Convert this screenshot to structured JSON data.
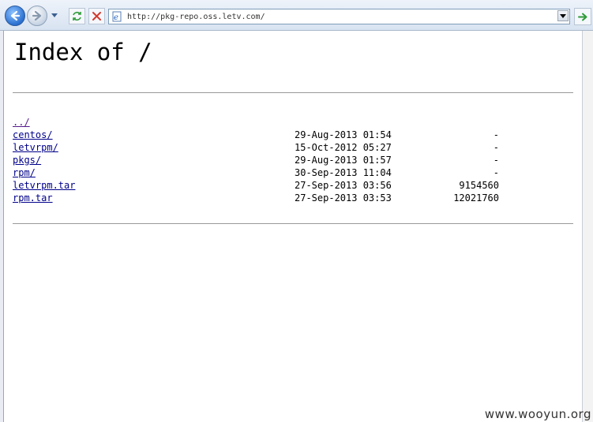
{
  "browser": {
    "address_url": "http://pkg-repo.oss.letv.com/"
  },
  "page": {
    "title": "Index of /",
    "entries": [
      {
        "name": "../",
        "date": "",
        "size": "",
        "visited": true
      },
      {
        "name": "centos/",
        "date": "29-Aug-2013 01:54",
        "size": "-"
      },
      {
        "name": "letvrpm/",
        "date": "15-Oct-2012 05:27",
        "size": "-"
      },
      {
        "name": "pkgs/",
        "date": "29-Aug-2013 01:57",
        "size": "-"
      },
      {
        "name": "rpm/",
        "date": "30-Sep-2013 11:04",
        "size": "-"
      },
      {
        "name": "letvrpm.tar",
        "date": "27-Sep-2013 03:56",
        "size": "9154560"
      },
      {
        "name": "rpm.tar",
        "date": "27-Sep-2013 03:53",
        "size": "12021760"
      }
    ]
  },
  "watermark": "www.wooyun.org",
  "colors": {
    "link": "#00008b",
    "visited_link": "#551a8b",
    "rule": "#999999",
    "toolbar_top": "#eef3fa",
    "toolbar_bottom": "#d8e3f1"
  },
  "icons": [
    "back-arrow-icon",
    "forward-arrow-icon",
    "dropdown-arrow-icon",
    "refresh-icon",
    "stop-icon",
    "page-icon",
    "go-arrow-icon"
  ]
}
